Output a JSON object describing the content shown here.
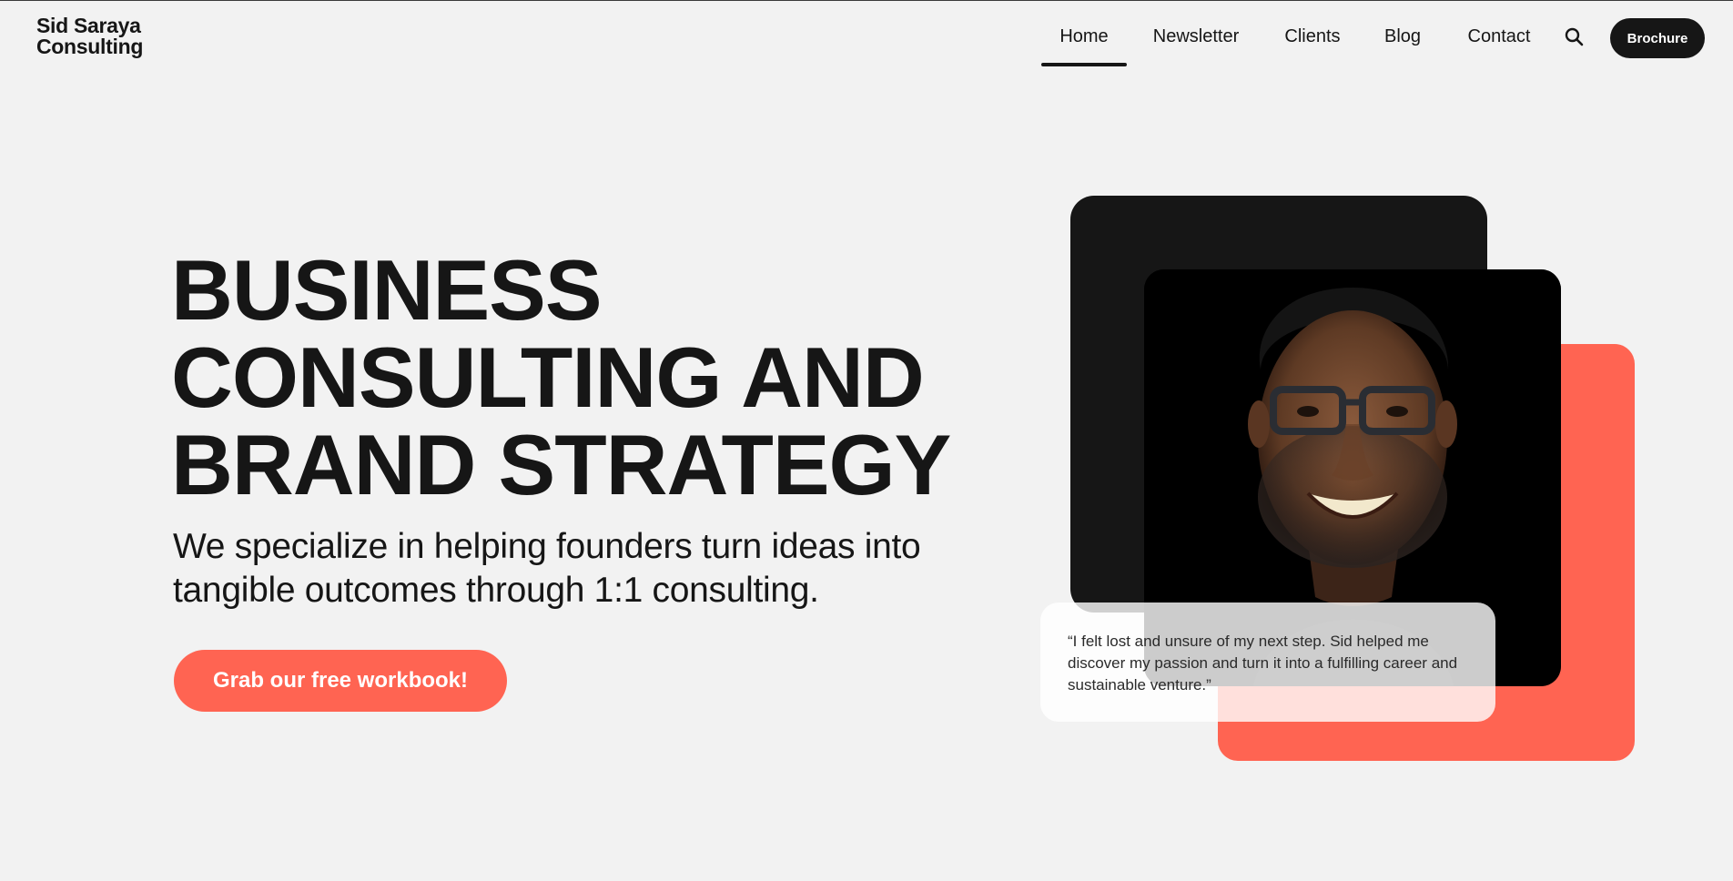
{
  "header": {
    "logo_line1": "Sid Saraya",
    "logo_line2": "Consulting",
    "nav": [
      {
        "label": "Home",
        "active": true
      },
      {
        "label": "Newsletter",
        "active": false
      },
      {
        "label": "Clients",
        "active": false
      },
      {
        "label": "Blog",
        "active": false
      },
      {
        "label": "Contact",
        "active": false
      }
    ],
    "search_icon": "search-icon",
    "brochure_label": "Brochure"
  },
  "hero": {
    "headline_lines": [
      "BUSINESS",
      "CONSULTING AND",
      "BRAND STRATEGY"
    ],
    "subtitle": "We specialize in helping founders turn ideas into tangible outcomes through 1:1 consulting.",
    "cta_label": "Grab our free workbook!"
  },
  "testimonial": {
    "quote": "“I felt lost and unsure of my next step. Sid helped me discover my passion and turn it into a fulfilling career and sustainable venture.”"
  },
  "colors": {
    "background": "#f2f2f2",
    "text": "#161616",
    "accent": "#ff6452",
    "dark_card": "#161616"
  }
}
